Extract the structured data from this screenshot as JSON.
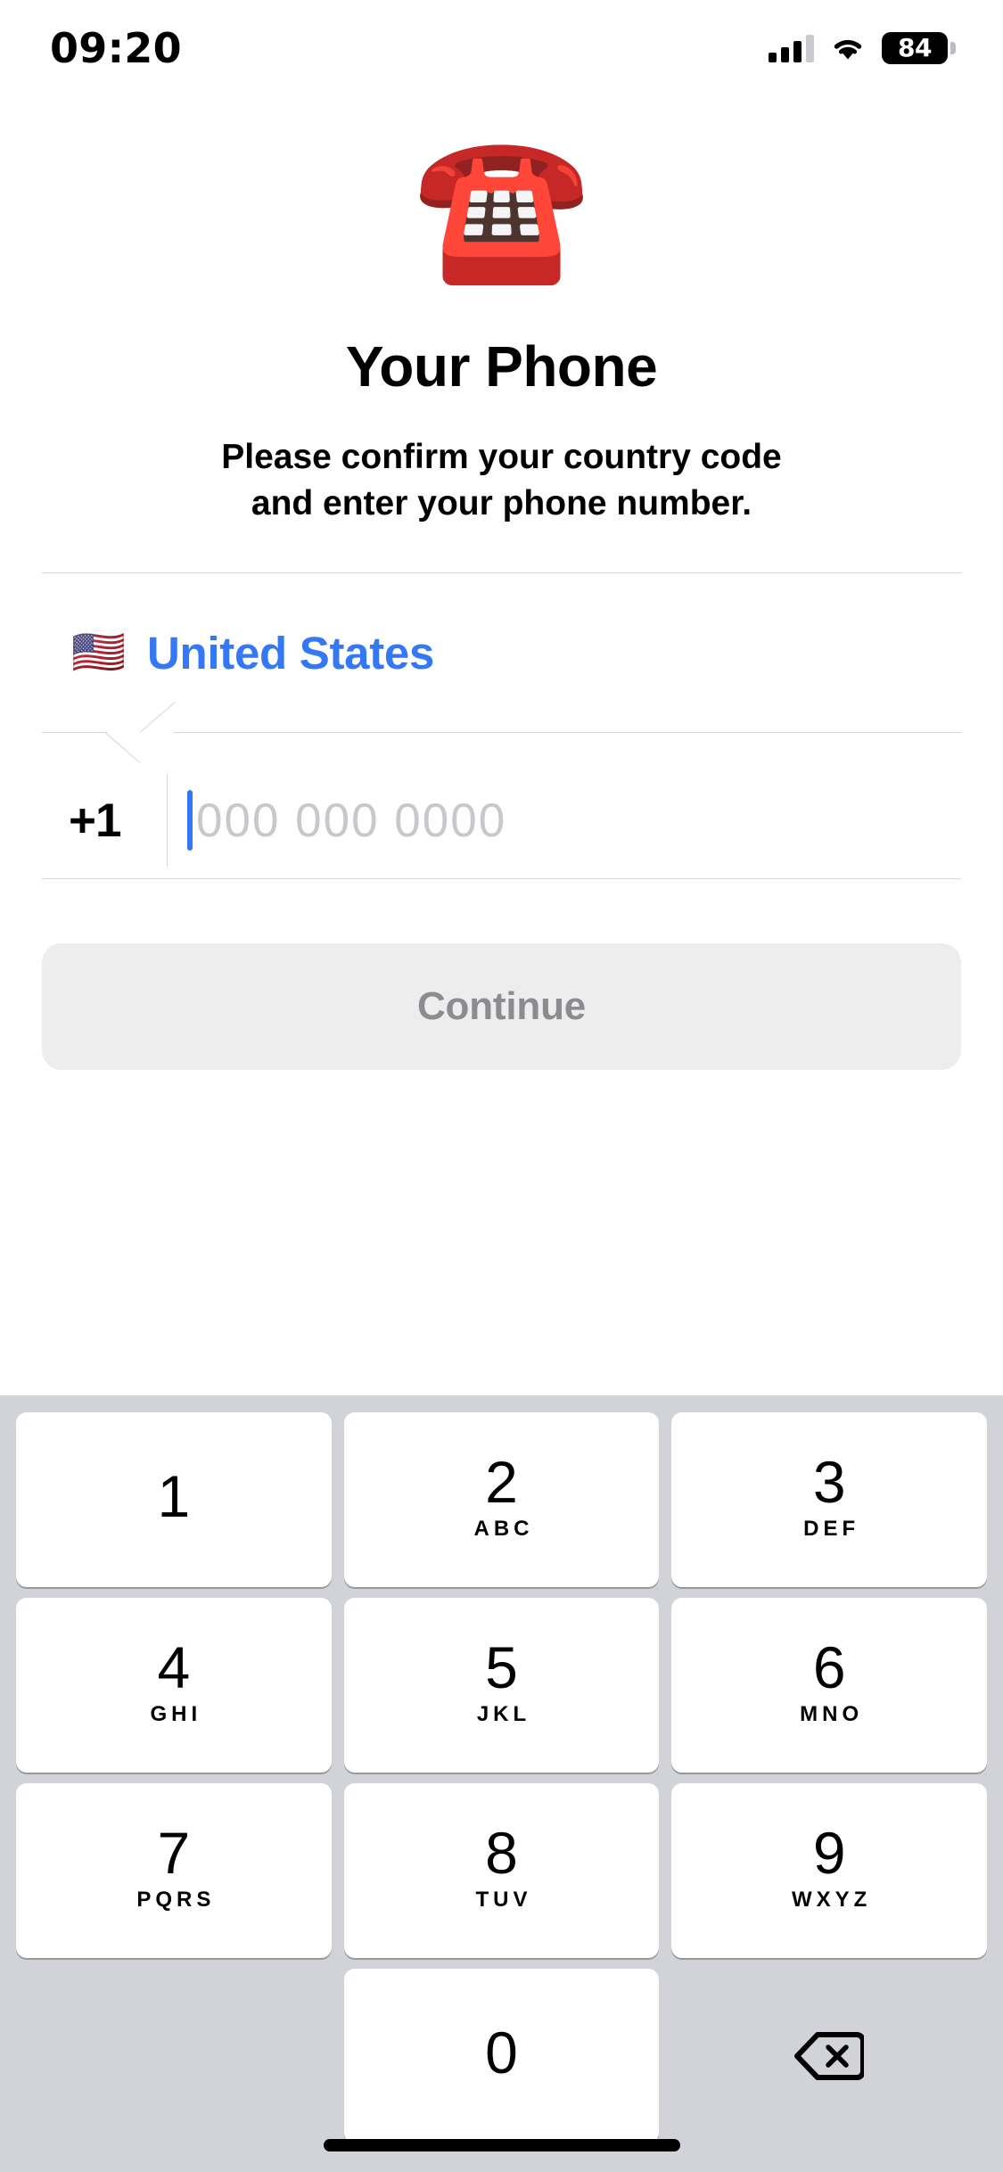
{
  "status_bar": {
    "time": "09:20",
    "battery_level": "84",
    "signal_icon": "cellular-bars-icon",
    "wifi_icon": "wifi-icon",
    "battery_icon": "battery-icon",
    "signal_bars_filled": 3,
    "signal_bars_total": 4
  },
  "hero": {
    "emoji": "☎️",
    "emoji_name": "telephone-emoji"
  },
  "page": {
    "title": "Your Phone",
    "subtitle_line1": "Please confirm your country code",
    "subtitle_line2": "and enter your phone number."
  },
  "form": {
    "country": {
      "flag": "🇺🇸",
      "name": "United States",
      "accent_color": "#3478F6"
    },
    "phone": {
      "country_code": "+1",
      "placeholder": "000 000 0000",
      "value": "",
      "caret_color": "#3478F6",
      "placeholder_color": "#C7C7CC"
    }
  },
  "continue_button": {
    "label": "Continue",
    "enabled": false,
    "background": "#EDEDEE",
    "text_color": "#8B8B90"
  },
  "keypad": {
    "background": "#D1D3D9",
    "key_background": "#FFFFFF",
    "rows": [
      [
        {
          "digit": "1",
          "letters": ""
        },
        {
          "digit": "2",
          "letters": "ABC"
        },
        {
          "digit": "3",
          "letters": "DEF"
        }
      ],
      [
        {
          "digit": "4",
          "letters": "GHI"
        },
        {
          "digit": "5",
          "letters": "JKL"
        },
        {
          "digit": "6",
          "letters": "MNO"
        }
      ],
      [
        {
          "digit": "7",
          "letters": "PQRS"
        },
        {
          "digit": "8",
          "letters": "TUV"
        },
        {
          "digit": "9",
          "letters": "WXYZ"
        }
      ]
    ],
    "zero_key": {
      "digit": "0",
      "letters": ""
    },
    "backspace_icon": "backspace-icon"
  }
}
